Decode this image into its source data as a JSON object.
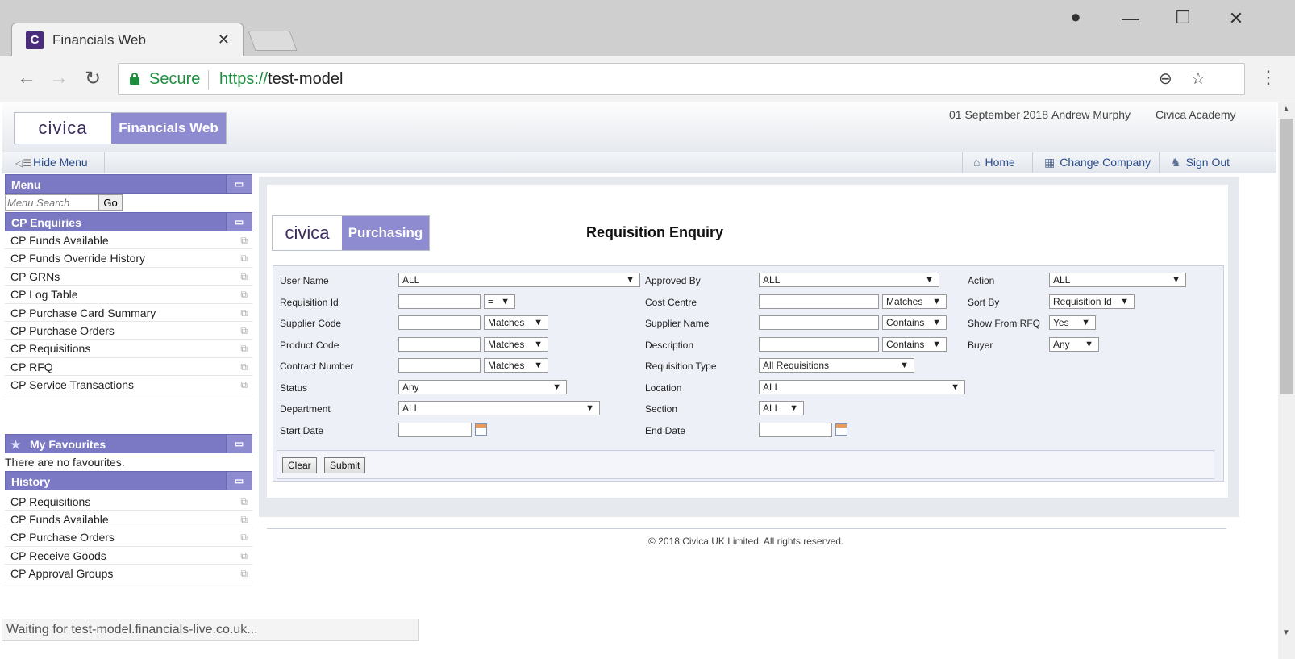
{
  "browser": {
    "tab_title": "Financials Web",
    "tab_icon_letter": "C",
    "secure_label": "Secure",
    "url_scheme": "https://",
    "url_host": "test-model",
    "status_text": "Waiting for test-model.financials-live.co.uk..."
  },
  "header": {
    "logo_civica": "civica",
    "logo_app": "Financials Web",
    "date": "01 September 2018",
    "user": "Andrew Murphy",
    "company": "Civica Academy"
  },
  "subbar": {
    "hide_menu": "Hide Menu",
    "home": "Home",
    "change_company": "Change Company",
    "sign_out": "Sign Out"
  },
  "sidebar": {
    "menu_title": "Menu",
    "search_placeholder": "Menu Search",
    "go_label": "Go",
    "enquiries_title": "CP Enquiries",
    "enquiries": [
      "CP Funds Available",
      "CP Funds Override History",
      "CP GRNs",
      "CP Log Table",
      "CP Purchase Card Summary",
      "CP Purchase Orders",
      "CP Requisitions",
      "CP RFQ",
      "CP Service Transactions"
    ],
    "favourites_title": "My Favourites",
    "no_favourites": "There are no favourites.",
    "history_title": "History",
    "history": [
      "CP Requisitions",
      "CP Funds Available",
      "CP Purchase Orders",
      "CP Receive Goods",
      "CP Approval Groups"
    ]
  },
  "content": {
    "logo_civica": "civica",
    "logo_module": "Purchasing",
    "title": "Requisition Enquiry",
    "fields": {
      "user_name": {
        "label": "User Name",
        "value": "ALL"
      },
      "approved_by": {
        "label": "Approved By",
        "value": "ALL"
      },
      "action": {
        "label": "Action",
        "value": "ALL"
      },
      "requisition_id": {
        "label": "Requisition Id",
        "op": "="
      },
      "cost_centre": {
        "label": "Cost Centre",
        "op": "Matches"
      },
      "sort_by": {
        "label": "Sort By",
        "value": "Requisition Id"
      },
      "supplier_code": {
        "label": "Supplier Code",
        "op": "Matches"
      },
      "supplier_name": {
        "label": "Supplier Name",
        "op": "Contains"
      },
      "show_from_rfq": {
        "label": "Show From RFQ",
        "value": "Yes"
      },
      "product_code": {
        "label": "Product Code",
        "op": "Matches"
      },
      "description": {
        "label": "Description",
        "op": "Contains"
      },
      "buyer": {
        "label": "Buyer",
        "value": "Any"
      },
      "contract_number": {
        "label": "Contract Number",
        "op": "Matches"
      },
      "requisition_type": {
        "label": "Requisition Type",
        "value": "All Requisitions"
      },
      "status": {
        "label": "Status",
        "value": "Any"
      },
      "location": {
        "label": "Location",
        "value": "ALL"
      },
      "department": {
        "label": "Department",
        "value": "ALL"
      },
      "section": {
        "label": "Section",
        "value": "ALL"
      },
      "start_date": {
        "label": "Start Date"
      },
      "end_date": {
        "label": "End Date"
      }
    },
    "clear_label": "Clear",
    "submit_label": "Submit"
  },
  "footer": {
    "copyright": "© 2018 Civica UK Limited. All rights reserved."
  },
  "colors": {
    "accent": "#7b78c4",
    "secure": "#1e8e3e",
    "link": "#2a4d8f"
  }
}
